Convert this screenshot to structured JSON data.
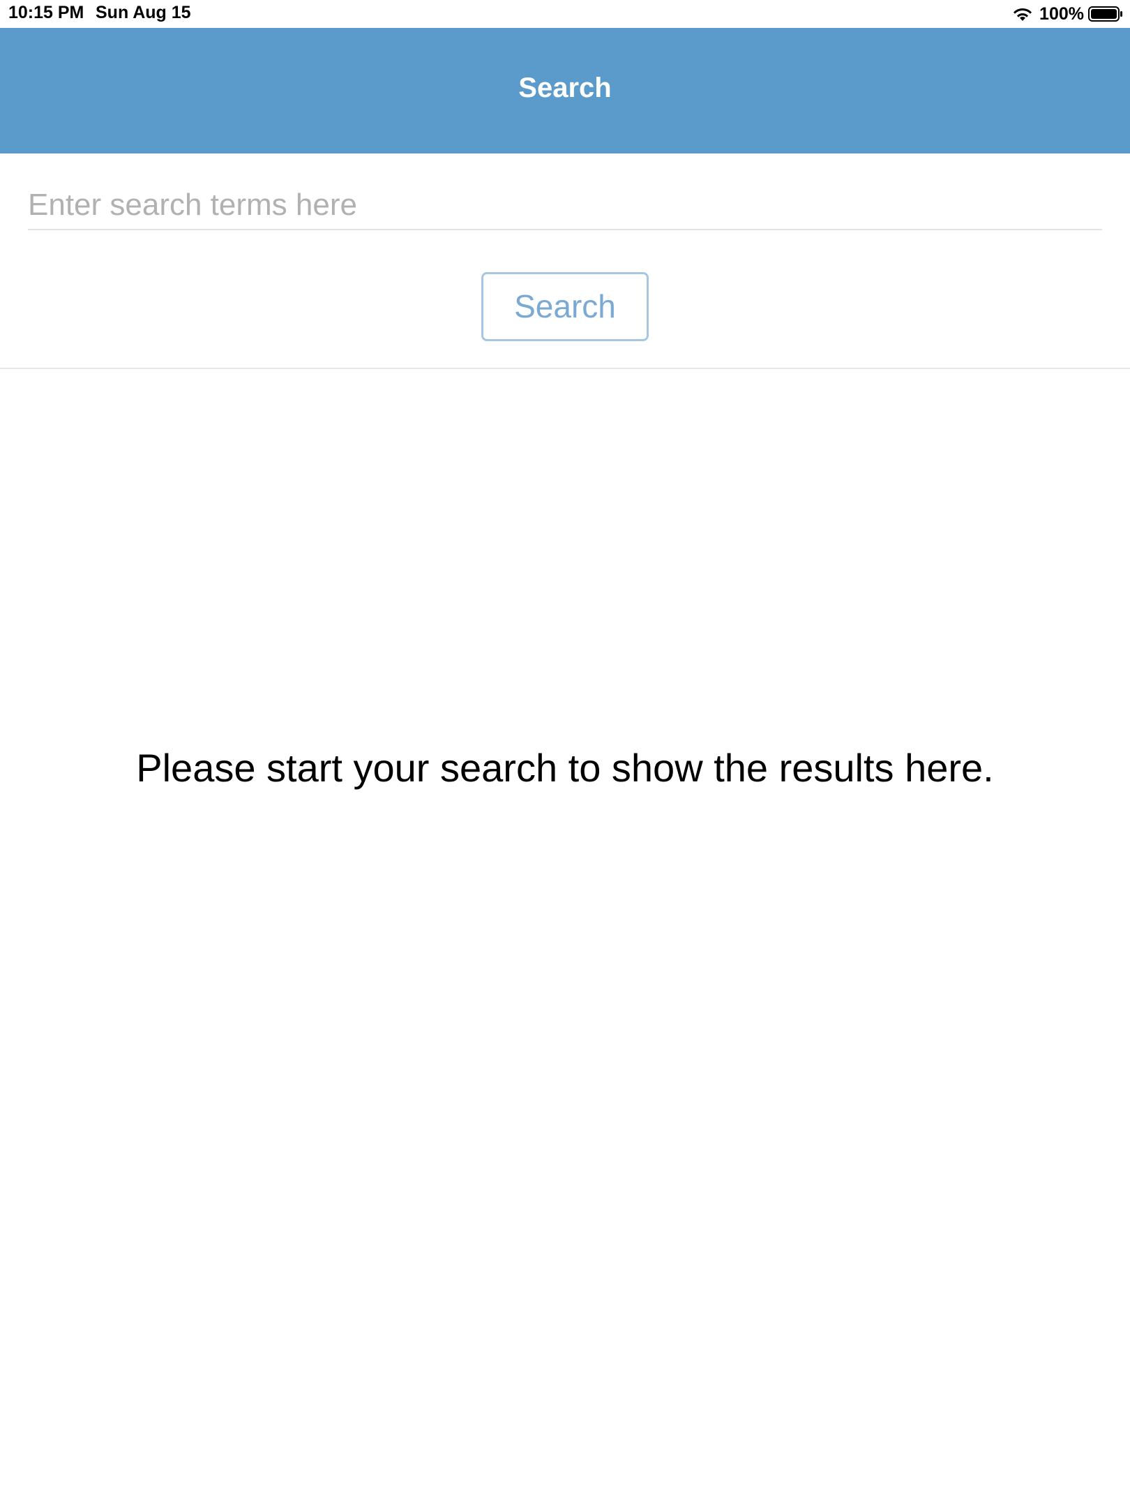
{
  "status_bar": {
    "time": "10:15 PM",
    "date": "Sun Aug 15",
    "battery": "100%",
    "icons": [
      "wifi-icon",
      "battery-icon"
    ]
  },
  "navbar": {
    "title": "Search",
    "background_color": "#5a9bcc"
  },
  "search": {
    "value": "",
    "placeholder": "Enter search terms here",
    "button_label": "Search"
  },
  "results": {
    "empty_message": "Please start your search to show the results here."
  }
}
